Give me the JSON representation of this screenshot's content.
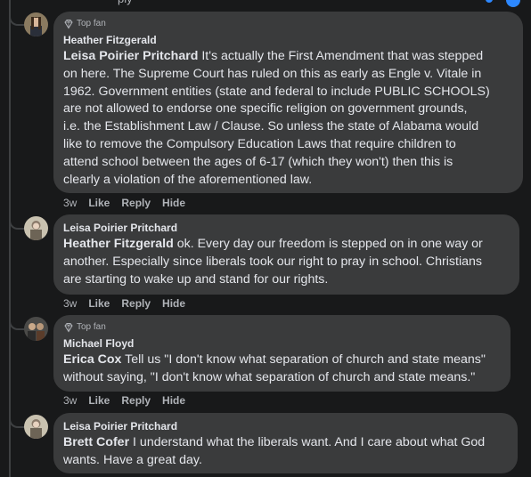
{
  "top_cut": {
    "text": "ply"
  },
  "comments": [
    {
      "badge": "Top fan",
      "author": "Heather Fitzgerald",
      "mention": "Leisa Poirier Pritchard",
      "lines": [
        " It's actually the First Amendment that was stepped",
        "on here. The Supreme Court has ruled on this as early as Engle v. Vitale in",
        "1962. Government entities (state and federal to include PUBLIC SCHOOLS)",
        "are not allowed to endorse one specific religion on government grounds,",
        "i.e. the Establishment Law / Clause. So unless the state of Alabama would",
        "like to remove the Compulsory Education Laws that require children to",
        "attend school between the ages of 6-17 (which they won't) then this is",
        "clearly a violation of the aforementioned law."
      ],
      "time": "3w",
      "like": "Like",
      "reply": "Reply",
      "hide": "Hide"
    },
    {
      "badge": "",
      "author": "Leisa Poirier Pritchard",
      "mention": "Heather Fitzgerald",
      "lines": [
        " ok. Every day our freedom is stepped on in one way or",
        "another. Especially since liberals took our right to pray in school. Christians",
        "are starting to wake up and stand for our rights."
      ],
      "time": "3w",
      "like": "Like",
      "reply": "Reply",
      "hide": "Hide"
    },
    {
      "badge": "Top fan",
      "author": "Michael Floyd",
      "mention": "Erica Cox",
      "lines": [
        " Tell us \"I don't know what separation of church and state means\"",
        "without saying, \"I don't know what separation of church and state means.\""
      ],
      "time": "3w",
      "like": "Like",
      "reply": "Reply",
      "hide": "Hide"
    },
    {
      "badge": "",
      "author": "Leisa Poirier Pritchard",
      "mention": "Brett Cofer",
      "lines": [
        " I understand what the liberals want. And I care about what God",
        "wants. Have a great day."
      ],
      "time": "",
      "like": "",
      "reply": "",
      "hide": ""
    }
  ],
  "colors": {
    "background": "#18191a",
    "bubble": "#3a3b3c",
    "text": "#e4e6eb",
    "muted": "#b0b3b8",
    "accent": "#2d88ff"
  },
  "icons": {
    "badge": "diamond-icon"
  }
}
